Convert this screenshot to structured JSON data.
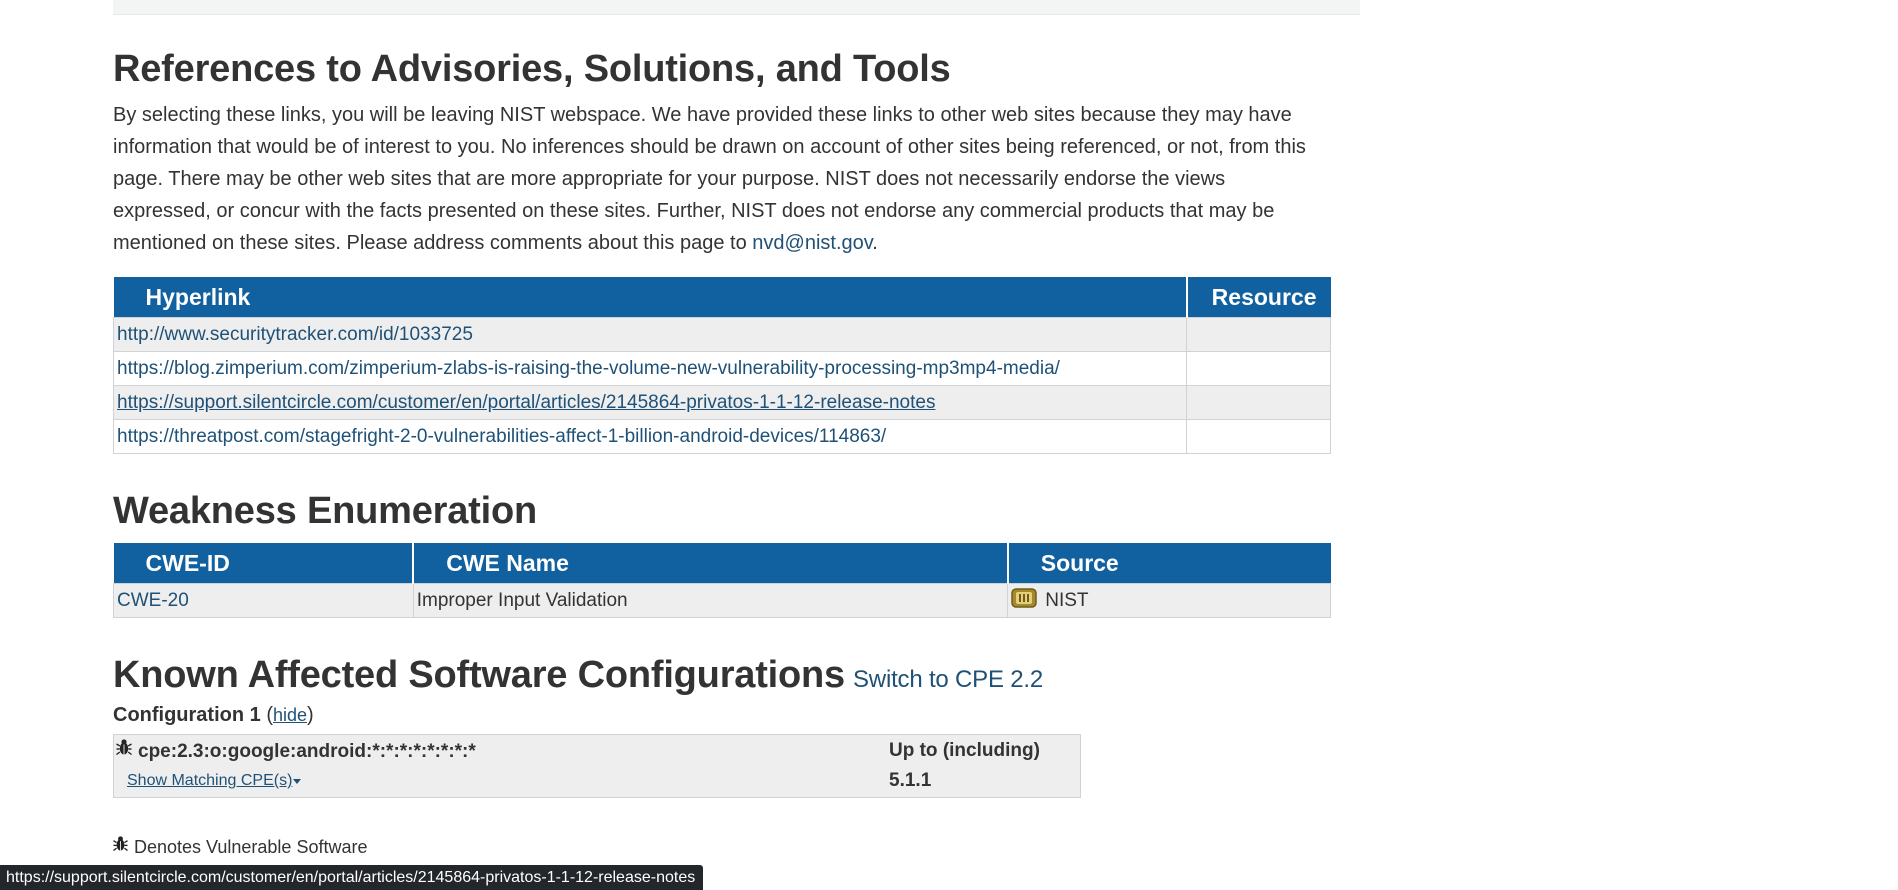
{
  "references": {
    "heading": "References to Advisories, Solutions, and Tools",
    "intro": "By selecting these links, you will be leaving NIST webspace. We have provided these links to other web sites because they may have information that would be of interest to you. No inferences should be drawn on account of other sites being referenced, or not, from this page. There may be other web sites that are more appropriate for your purpose. NIST does not necessarily endorse the views expressed, or concur with the facts presented on these sites. Further, NIST does not endorse any commercial products that may be mentioned on these sites. Please address comments about this page to ",
    "email": "nvd@nist.gov",
    "intro_end": ".",
    "columns": [
      "Hyperlink",
      "Resource"
    ],
    "rows": [
      {
        "hyperlink": "http://www.securitytracker.com/id/1033725",
        "resource": ""
      },
      {
        "hyperlink": "https://blog.zimperium.com/zimperium-zlabs-is-raising-the-volume-new-vulnerability-processing-mp3mp4-media/",
        "resource": ""
      },
      {
        "hyperlink": "https://support.silentcircle.com/customer/en/portal/articles/2145864-privatos-1-1-12-release-notes",
        "resource": ""
      },
      {
        "hyperlink": "https://threatpost.com/stagefright-2-0-vulnerabilities-affect-1-billion-android-devices/114863/",
        "resource": ""
      }
    ]
  },
  "weakness": {
    "heading": "Weakness Enumeration",
    "columns": [
      "CWE-ID",
      "CWE Name",
      "Source"
    ],
    "rows": [
      {
        "cwe_id": "CWE-20",
        "cwe_name": "Improper Input Validation",
        "source": "NIST",
        "source_icon": "nist-icon"
      }
    ]
  },
  "configurations": {
    "heading": "Known Affected Software Configurations",
    "switch_link": "Switch to CPE 2.2",
    "config_title": "Configuration 1",
    "open_paren": "(",
    "hide_label": "hide",
    "close_paren": ")",
    "cpe": "cpe:2.3:o:google:android:*:*:*:*:*:*:*:*",
    "show_matching": "Show Matching CPE(s)",
    "show_matching_icon": "caret-down-icon",
    "upto_label": "Up to (including)",
    "version": "5.1.1",
    "vulnerable_icon": "bug-icon",
    "denotes": "Denotes Vulnerable Software"
  },
  "status_bar": {
    "url": "https://support.silentcircle.com/customer/en/portal/articles/2145864-privatos-1-1-12-release-notes"
  },
  "colors": {
    "table_header": "#1160a0",
    "link": "#1f5177",
    "row_alt": "#eeeeee",
    "status_bar": "#23262a"
  }
}
